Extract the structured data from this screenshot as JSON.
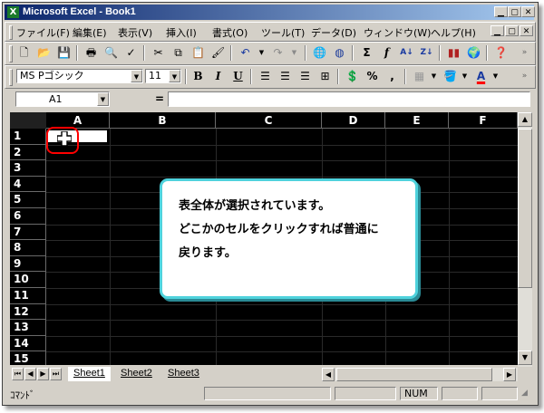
{
  "window": {
    "title": "Microsoft Excel - Book1"
  },
  "menu": [
    "ファイル(F)",
    "編集(E)",
    "表示(V)",
    "挿入(I)",
    "書式(O)",
    "ツール(T)",
    "データ(D)",
    "ウィンドウ(W)",
    "ヘルプ(H)"
  ],
  "format_toolbar": {
    "font_name": "MS Pゴシック",
    "font_size": "11",
    "bold": "B",
    "italic": "I",
    "underline": "U",
    "percent": "%",
    "comma": ","
  },
  "standard_toolbar": {
    "sum": "Σ",
    "fx": "f",
    "sort_asc": "A↓",
    "sort_desc": "Z↓"
  },
  "formula_bar": {
    "name_box": "A1",
    "equals": "="
  },
  "columns": [
    "A",
    "B",
    "C",
    "D",
    "E",
    "F"
  ],
  "rows": [
    "1",
    "2",
    "3",
    "4",
    "5",
    "6",
    "7",
    "8",
    "9",
    "10",
    "11",
    "12",
    "13",
    "14",
    "15"
  ],
  "sheets": [
    "Sheet1",
    "Sheet2",
    "Sheet3"
  ],
  "active_sheet": "Sheet1",
  "status": {
    "mode": "ｺﾏﾝﾄﾞ",
    "num": "NUM"
  },
  "callout": {
    "line1": "表全体が選択されています。",
    "line2": "どこかのセルをクリックすれば普通に",
    "line3": "戻ります。"
  },
  "colors": {
    "title_gradient_start": "#0a246a",
    "title_gradient_end": "#a6caf0",
    "callout_border": "#4fd2dc",
    "highlight_ring": "#ff0000",
    "selection_bg": "#000000"
  }
}
